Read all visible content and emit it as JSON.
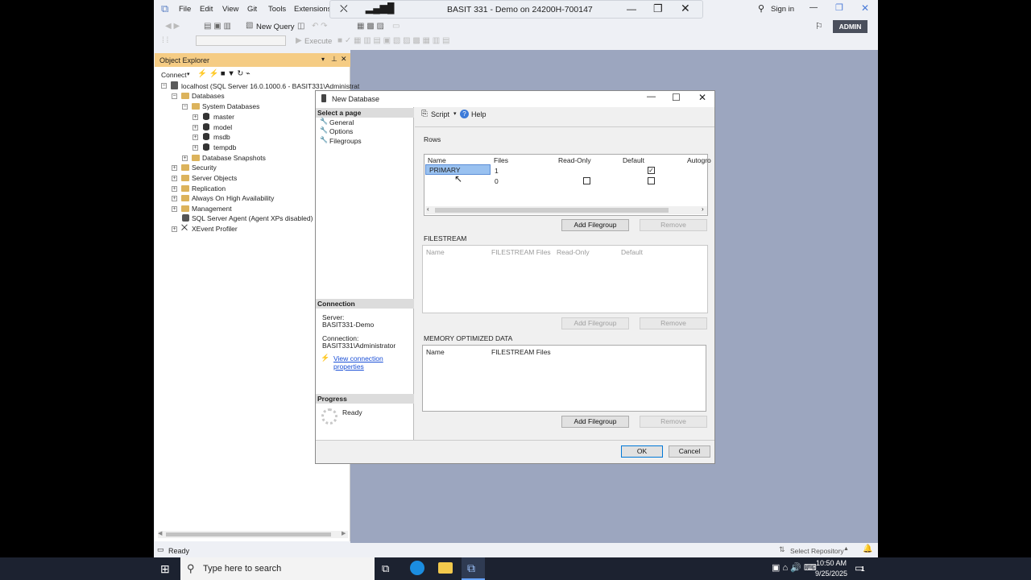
{
  "ssms": {
    "menu": [
      "File",
      "Edit",
      "View",
      "Git",
      "Tools",
      "Extensions"
    ],
    "sign_in": "Sign in",
    "admin_badge": "ADMIN",
    "new_query": "New Query",
    "execute": "Execute",
    "status": "Ready"
  },
  "rdp": {
    "title": "BASIT 331 - Demo on 24200H-700147"
  },
  "object_explorer": {
    "title": "Object Explorer",
    "connect": "Connect",
    "tree": [
      {
        "label": "localhost (SQL Server 16.0.1000.6 - BASIT331\\Administrat",
        "expander": "⊟"
      },
      {
        "label": "Databases",
        "expander": "⊟"
      },
      {
        "label": "System Databases",
        "expander": "⊟"
      },
      {
        "label": "master",
        "expander": "⊞"
      },
      {
        "label": "model",
        "expander": "⊞"
      },
      {
        "label": "msdb",
        "expander": "⊞"
      },
      {
        "label": "tempdb",
        "expander": "⊞"
      },
      {
        "label": "Database Snapshots",
        "expander": "⊞"
      },
      {
        "label": "Security",
        "expander": "⊞"
      },
      {
        "label": "Server Objects",
        "expander": "⊞"
      },
      {
        "label": "Replication",
        "expander": "⊞"
      },
      {
        "label": "Always On High Availability",
        "expander": "⊞"
      },
      {
        "label": "Management",
        "expander": "⊞"
      },
      {
        "label": "SQL Server Agent (Agent XPs disabled)",
        "expander": ""
      },
      {
        "label": "XEvent Profiler",
        "expander": "⊞"
      }
    ]
  },
  "dialog": {
    "title": "New Database",
    "select_page": "Select a page",
    "pages": [
      "General",
      "Options",
      "Filegroups"
    ],
    "script": "Script",
    "help": "Help",
    "connection_header": "Connection",
    "server_label": "Server:",
    "server_value": "BASIT331-Demo",
    "connection_label": "Connection:",
    "connection_value": "BASIT331\\Administrator",
    "view_conn_props": "View connection properties",
    "progress_header": "Progress",
    "progress_status": "Ready",
    "rows_label": "Rows",
    "rows_columns": [
      "Name",
      "Files",
      "Read-Only",
      "Default",
      "Autogro"
    ],
    "rows": [
      {
        "name": "PRIMARY",
        "files": "1"
      },
      {
        "name": "",
        "files": "0"
      }
    ],
    "add_filegroup": "Add Filegroup",
    "remove": "Remove",
    "filestream_label": "FILESTREAM",
    "filestream_columns": [
      "Name",
      "FILESTREAM Files",
      "Read-Only",
      "Default"
    ],
    "memopt_label": "MEMORY OPTIMIZED DATA",
    "memopt_columns": [
      "Name",
      "FILESTREAM Files"
    ],
    "ok": "OK",
    "cancel": "Cancel"
  },
  "taskbar": {
    "search_placeholder": "Type here to search",
    "time": "10:50 AM",
    "date": "9/25/2025",
    "select_repo": "Select Repository",
    "notif_count": "1"
  }
}
